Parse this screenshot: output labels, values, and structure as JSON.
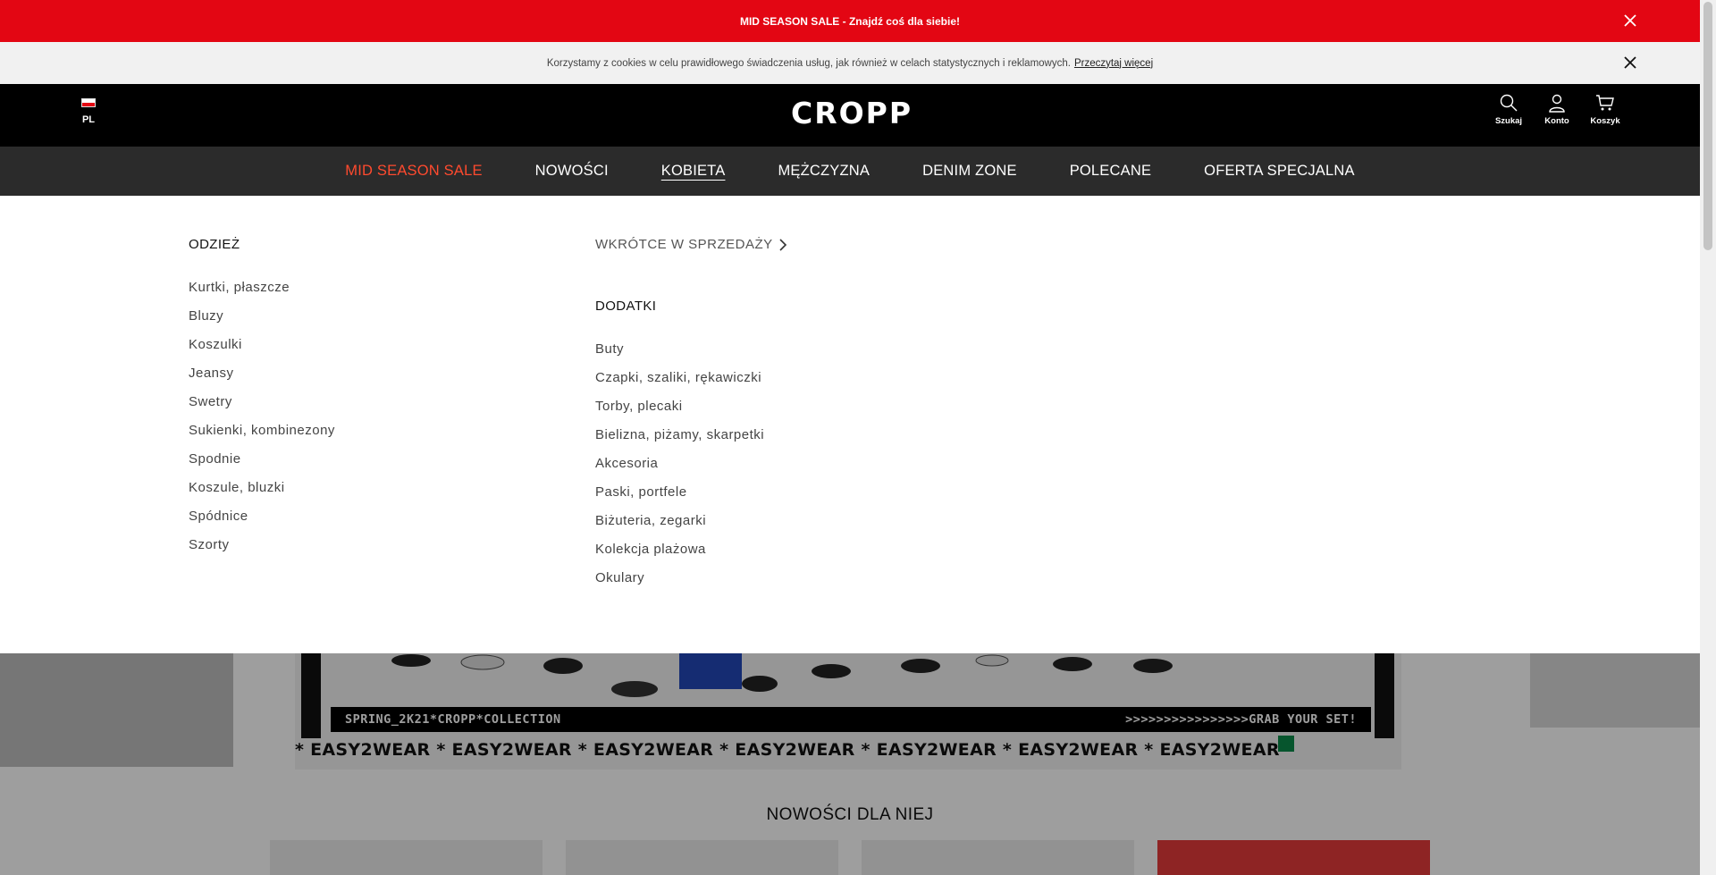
{
  "promo": {
    "text": "MID SEASON SALE - Znajdź coś dla siebie!"
  },
  "cookie": {
    "text": "Korzystamy z cookies w celu prawidłowego świadczenia usług, jak również w celach statystycznych i reklamowych.",
    "link": "Przeczytaj więcej"
  },
  "header": {
    "lang": "PL",
    "logo": "CROPP",
    "search_label": "Szukaj",
    "account_label": "Konto",
    "cart_label": "Koszyk"
  },
  "nav": {
    "items": [
      "MID SEASON SALE",
      "NOWOŚCI",
      "KOBIETA",
      "MĘŻCZYZNA",
      "DENIM ZONE",
      "POLECANE",
      "OFERTA SPECJALNA"
    ],
    "active": "KOBIETA"
  },
  "mega": {
    "col1": {
      "title": "ODZIEŻ",
      "items": [
        "Kurtki, płaszcze",
        "Bluzy",
        "Koszulki",
        "Jeansy",
        "Swetry",
        "Sukienki, kombinezony",
        "Spodnie",
        "Koszule, bluzki",
        "Spódnice",
        "Szorty"
      ]
    },
    "col2": {
      "soon": "WKRÓTCE W SPRZEDAŻY",
      "title": "DODATKI",
      "items": [
        "Buty",
        "Czapki, szaliki, rękawiczki",
        "Torby, plecaki",
        "Bielizna, piżamy, skarpetki",
        "Akcesoria",
        "Paski, portfele",
        "Biżuteria, zegarki",
        "Kolekcja plażowa",
        "Okulary"
      ]
    }
  },
  "banner": {
    "strip_left": "SPRING_2K21*CROPP*COLLECTION",
    "strip_right": ">>>>>>>>>>>>>>>>GRAB YOUR SET!",
    "easy": "* EASY2WEAR * EASY2WEAR * EASY2WEAR * EASY2WEAR * EASY2WEAR * EASY2WEAR * EASY2WEAR"
  },
  "section": {
    "title": "NOWOŚCI DLA NIEJ"
  },
  "colors": {
    "promo": "#e30613",
    "nav_bg": "#2b2b2b",
    "sale": "#ff4a2e",
    "header_bg": "#000000"
  }
}
